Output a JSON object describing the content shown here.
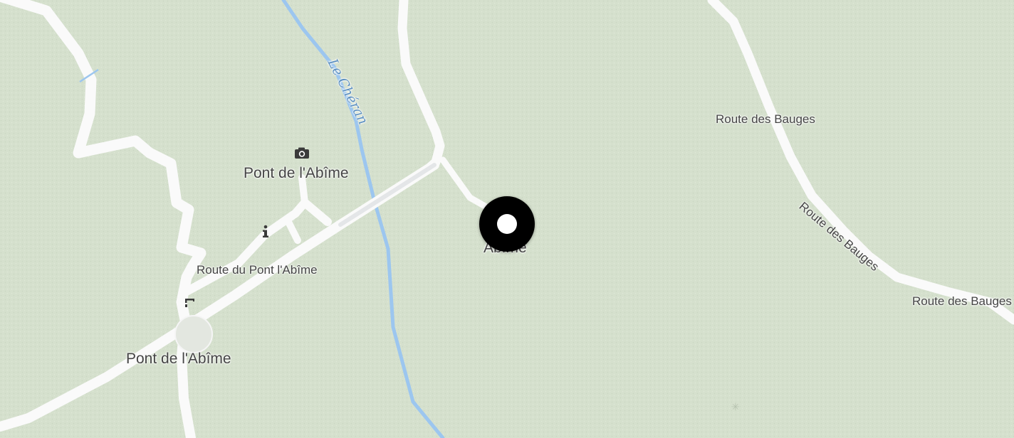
{
  "map": {
    "colors": {
      "land": "#d5e0cd",
      "road": "#fafafa",
      "water": "#9cc6ef",
      "label": "#444444",
      "river_label": "#5b8fc0",
      "marker": "#000000"
    },
    "labels": {
      "pont_top": "Pont de l'Abîme",
      "pont_bottom": "Pont de l'Abîme",
      "route_pont": "Route du Pont l'Abîme",
      "river": "Le Chéran",
      "route_bauges_1": "Route des Bauges",
      "route_bauges_2": "Route des Bauges",
      "route_bauges_3": "Route des Bauges",
      "marker_label": "Abîme"
    },
    "icons": [
      "camera-icon",
      "info-icon",
      "bus-stop-icon",
      "location-marker-icon"
    ]
  }
}
